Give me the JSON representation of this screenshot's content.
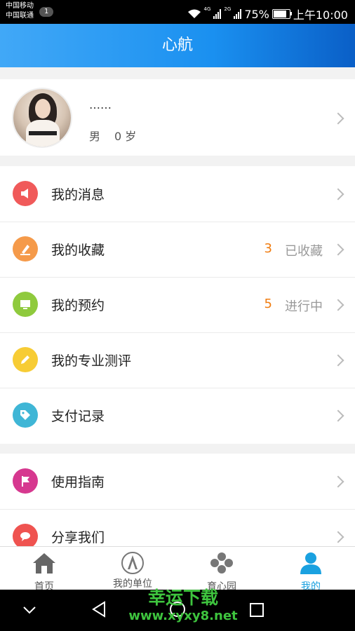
{
  "statusbar": {
    "carrier1": "中国移动",
    "carrier2": "中国联通",
    "notification_count": "1",
    "net1": "4G",
    "net2": "2G",
    "battery_percent": "75%",
    "battery_level": 0.75,
    "time": "上午10:00"
  },
  "header": {
    "title": "心航"
  },
  "profile": {
    "nickname": "……",
    "gender": "男",
    "age": "0 岁"
  },
  "menu_group1": [
    {
      "label": "我的消息",
      "icon": "speaker-icon",
      "color": "#f05a5a"
    },
    {
      "label": "我的收藏",
      "icon": "bookmark-icon",
      "color": "#f59a4a",
      "count": "3",
      "status": "已收藏"
    },
    {
      "label": "我的预约",
      "icon": "monitor-icon",
      "color": "#8fca3d",
      "count": "5",
      "status": "进行中"
    },
    {
      "label": "我的专业测评",
      "icon": "pencil-icon",
      "color": "#f7cc35"
    },
    {
      "label": "支付记录",
      "icon": "tag-icon",
      "color": "#3fb6d6"
    }
  ],
  "menu_group2": [
    {
      "label": "使用指南",
      "icon": "flag-icon",
      "color": "#d6388f"
    },
    {
      "label": "分享我们",
      "icon": "chat-bubble-icon",
      "color": "#ef5350"
    }
  ],
  "bottom_nav": [
    {
      "label": "首页",
      "icon": "home-icon",
      "active": false
    },
    {
      "label": "我的单位",
      "icon": "caac-logo-icon",
      "active": false
    },
    {
      "label": "育心园",
      "icon": "flower-icon",
      "active": false
    },
    {
      "label": "我的",
      "icon": "person-icon",
      "active": true
    }
  ],
  "colors": {
    "accent": "#1a90f0",
    "active_tab": "#1aa1e0",
    "count": "#f07c10"
  },
  "watermark": {
    "line1": "幸运下载",
    "line2": "www.xyxy8.net"
  }
}
